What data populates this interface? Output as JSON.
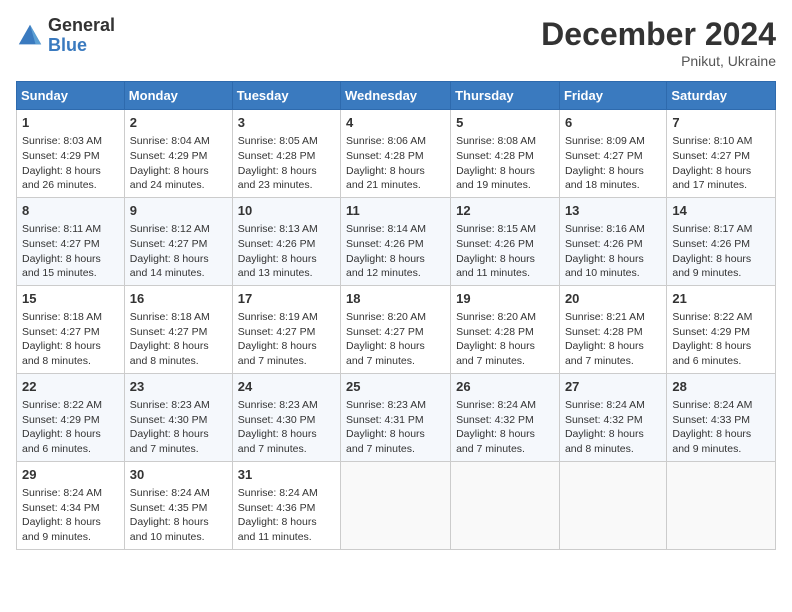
{
  "header": {
    "logo_general": "General",
    "logo_blue": "Blue",
    "month_title": "December 2024",
    "subtitle": "Pnikut, Ukraine"
  },
  "days_of_week": [
    "Sunday",
    "Monday",
    "Tuesday",
    "Wednesday",
    "Thursday",
    "Friday",
    "Saturday"
  ],
  "weeks": [
    [
      {
        "day": 1,
        "sunrise": "8:03 AM",
        "sunset": "4:29 PM",
        "daylight": "8 hours and 26 minutes."
      },
      {
        "day": 2,
        "sunrise": "8:04 AM",
        "sunset": "4:29 PM",
        "daylight": "8 hours and 24 minutes."
      },
      {
        "day": 3,
        "sunrise": "8:05 AM",
        "sunset": "4:28 PM",
        "daylight": "8 hours and 23 minutes."
      },
      {
        "day": 4,
        "sunrise": "8:06 AM",
        "sunset": "4:28 PM",
        "daylight": "8 hours and 21 minutes."
      },
      {
        "day": 5,
        "sunrise": "8:08 AM",
        "sunset": "4:28 PM",
        "daylight": "8 hours and 19 minutes."
      },
      {
        "day": 6,
        "sunrise": "8:09 AM",
        "sunset": "4:27 PM",
        "daylight": "8 hours and 18 minutes."
      },
      {
        "day": 7,
        "sunrise": "8:10 AM",
        "sunset": "4:27 PM",
        "daylight": "8 hours and 17 minutes."
      }
    ],
    [
      {
        "day": 8,
        "sunrise": "8:11 AM",
        "sunset": "4:27 PM",
        "daylight": "8 hours and 15 minutes."
      },
      {
        "day": 9,
        "sunrise": "8:12 AM",
        "sunset": "4:27 PM",
        "daylight": "8 hours and 14 minutes."
      },
      {
        "day": 10,
        "sunrise": "8:13 AM",
        "sunset": "4:26 PM",
        "daylight": "8 hours and 13 minutes."
      },
      {
        "day": 11,
        "sunrise": "8:14 AM",
        "sunset": "4:26 PM",
        "daylight": "8 hours and 12 minutes."
      },
      {
        "day": 12,
        "sunrise": "8:15 AM",
        "sunset": "4:26 PM",
        "daylight": "8 hours and 11 minutes."
      },
      {
        "day": 13,
        "sunrise": "8:16 AM",
        "sunset": "4:26 PM",
        "daylight": "8 hours and 10 minutes."
      },
      {
        "day": 14,
        "sunrise": "8:17 AM",
        "sunset": "4:26 PM",
        "daylight": "8 hours and 9 minutes."
      }
    ],
    [
      {
        "day": 15,
        "sunrise": "8:18 AM",
        "sunset": "4:27 PM",
        "daylight": "8 hours and 8 minutes."
      },
      {
        "day": 16,
        "sunrise": "8:18 AM",
        "sunset": "4:27 PM",
        "daylight": "8 hours and 8 minutes."
      },
      {
        "day": 17,
        "sunrise": "8:19 AM",
        "sunset": "4:27 PM",
        "daylight": "8 hours and 7 minutes."
      },
      {
        "day": 18,
        "sunrise": "8:20 AM",
        "sunset": "4:27 PM",
        "daylight": "8 hours and 7 minutes."
      },
      {
        "day": 19,
        "sunrise": "8:20 AM",
        "sunset": "4:28 PM",
        "daylight": "8 hours and 7 minutes."
      },
      {
        "day": 20,
        "sunrise": "8:21 AM",
        "sunset": "4:28 PM",
        "daylight": "8 hours and 7 minutes."
      },
      {
        "day": 21,
        "sunrise": "8:22 AM",
        "sunset": "4:29 PM",
        "daylight": "8 hours and 6 minutes."
      }
    ],
    [
      {
        "day": 22,
        "sunrise": "8:22 AM",
        "sunset": "4:29 PM",
        "daylight": "8 hours and 6 minutes."
      },
      {
        "day": 23,
        "sunrise": "8:23 AM",
        "sunset": "4:30 PM",
        "daylight": "8 hours and 7 minutes."
      },
      {
        "day": 24,
        "sunrise": "8:23 AM",
        "sunset": "4:30 PM",
        "daylight": "8 hours and 7 minutes."
      },
      {
        "day": 25,
        "sunrise": "8:23 AM",
        "sunset": "4:31 PM",
        "daylight": "8 hours and 7 minutes."
      },
      {
        "day": 26,
        "sunrise": "8:24 AM",
        "sunset": "4:32 PM",
        "daylight": "8 hours and 7 minutes."
      },
      {
        "day": 27,
        "sunrise": "8:24 AM",
        "sunset": "4:32 PM",
        "daylight": "8 hours and 8 minutes."
      },
      {
        "day": 28,
        "sunrise": "8:24 AM",
        "sunset": "4:33 PM",
        "daylight": "8 hours and 9 minutes."
      }
    ],
    [
      {
        "day": 29,
        "sunrise": "8:24 AM",
        "sunset": "4:34 PM",
        "daylight": "8 hours and 9 minutes."
      },
      {
        "day": 30,
        "sunrise": "8:24 AM",
        "sunset": "4:35 PM",
        "daylight": "8 hours and 10 minutes."
      },
      {
        "day": 31,
        "sunrise": "8:24 AM",
        "sunset": "4:36 PM",
        "daylight": "8 hours and 11 minutes."
      },
      null,
      null,
      null,
      null
    ]
  ]
}
